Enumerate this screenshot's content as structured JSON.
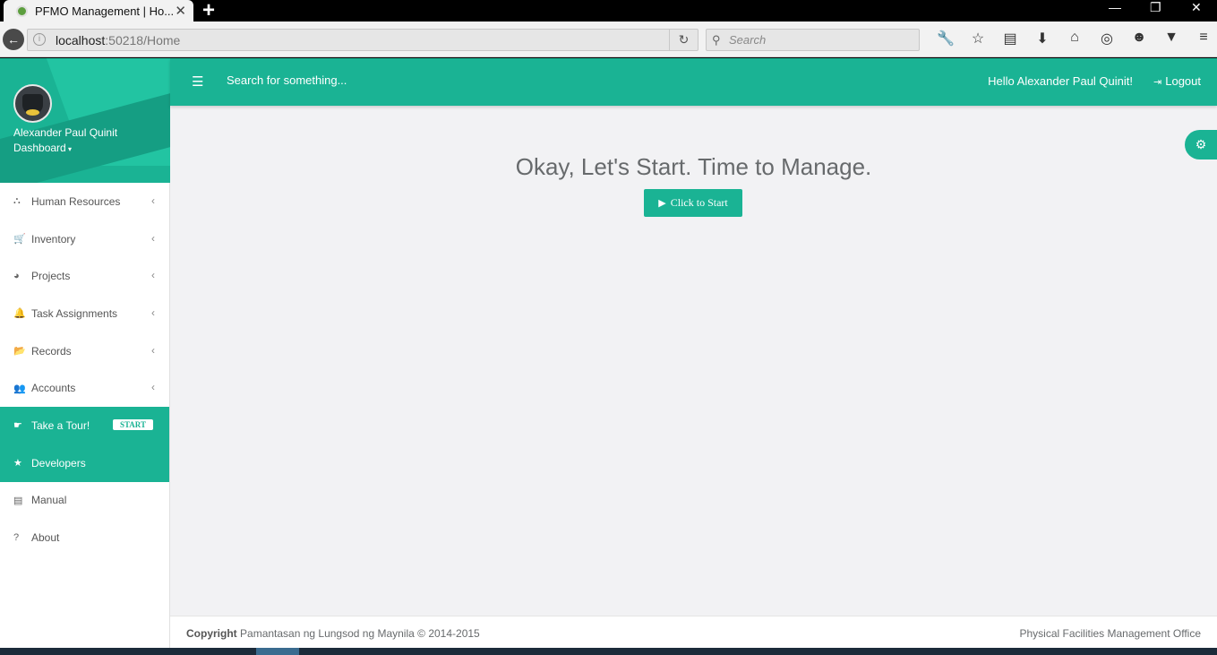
{
  "browser": {
    "tab_title": "PFMO Management | Ho...",
    "url_host": "localhost",
    "url_path": ":50218/Home",
    "search_placeholder": "Search"
  },
  "sidebar": {
    "user_name": "Alexander Paul Quinit",
    "dashboard_label": "Dashboard",
    "items": [
      {
        "label": "Human Resources",
        "icon": "sitemap-icon"
      },
      {
        "label": "Inventory",
        "icon": "cart-icon"
      },
      {
        "label": "Projects",
        "icon": "pie-chart-icon"
      },
      {
        "label": "Task Assignments",
        "icon": "bell-icon"
      },
      {
        "label": "Records",
        "icon": "folder-open-icon"
      },
      {
        "label": "Accounts",
        "icon": "users-icon"
      },
      {
        "label": "Take a Tour!",
        "icon": "hand-pointer-icon",
        "badge": "START"
      },
      {
        "label": "Developers",
        "icon": "star-icon"
      },
      {
        "label": "Manual",
        "icon": "file-icon"
      },
      {
        "label": "About",
        "icon": "question-circle-icon"
      }
    ]
  },
  "topbar": {
    "search_placeholder": "Search for something...",
    "greeting": "Hello Alexander Paul Quinit!",
    "logout_label": "Logout"
  },
  "main": {
    "heading": "Okay, Let's Start. Time to Manage.",
    "start_button_label": "Click to Start"
  },
  "footer": {
    "copyright_label": "Copyright",
    "copyright_text": "Pamantasan ng Lungsod ng Maynila © 2014-2015",
    "office": "Physical Facilities Management Office"
  },
  "colors": {
    "accent": "#1ab394",
    "text": "#676a6c",
    "background": "#f2f2f4"
  }
}
